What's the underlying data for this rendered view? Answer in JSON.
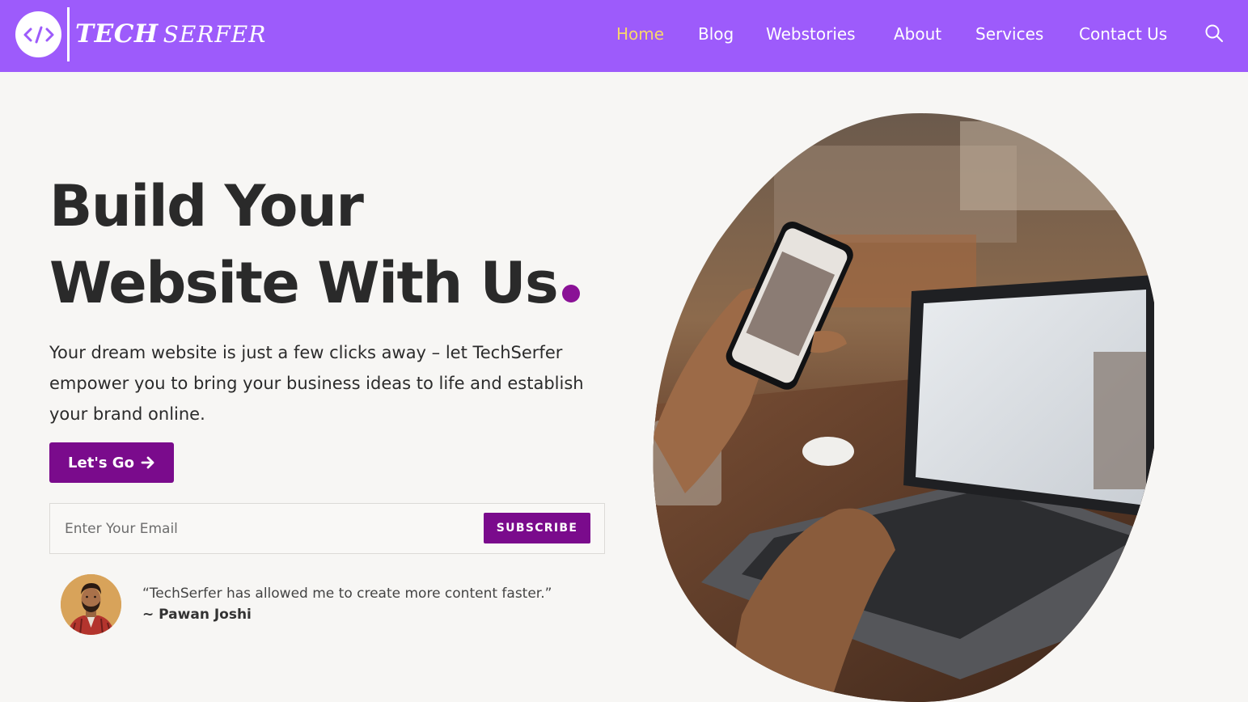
{
  "brand": {
    "logo_icon": "code-brackets-icon",
    "name_part1": "TECH",
    "name_part2": "SERFER",
    "accent_color": "#9d5bfb",
    "primary_color": "#7a0b8c"
  },
  "nav": {
    "items": [
      {
        "label": "Home",
        "active": true
      },
      {
        "label": "Blog",
        "active": false
      },
      {
        "label": "Webstories",
        "active": false
      },
      {
        "label": "About",
        "active": false
      },
      {
        "label": "Services",
        "active": false
      },
      {
        "label": "Contact Us",
        "active": false
      }
    ],
    "search_icon": "search-icon"
  },
  "hero": {
    "headline_line1": "Build Your",
    "headline_line2": "Website With Us",
    "intro": "Your dream website is just a few clicks away – let TechSerfer empower you to bring your business ideas to life and establish your brand online.",
    "cta_label": "Let's Go",
    "cta_icon": "arrow-right-icon"
  },
  "subscribe": {
    "placeholder": "Enter Your Email",
    "value": "",
    "button_label": "SUBSCRIBE"
  },
  "testimonial": {
    "quote": "“TechSerfer has allowed me to create more content faster.”",
    "author": "~ Pawan Joshi"
  },
  "hero_image": {
    "description_icon": "hands-phone-laptop-photo"
  }
}
